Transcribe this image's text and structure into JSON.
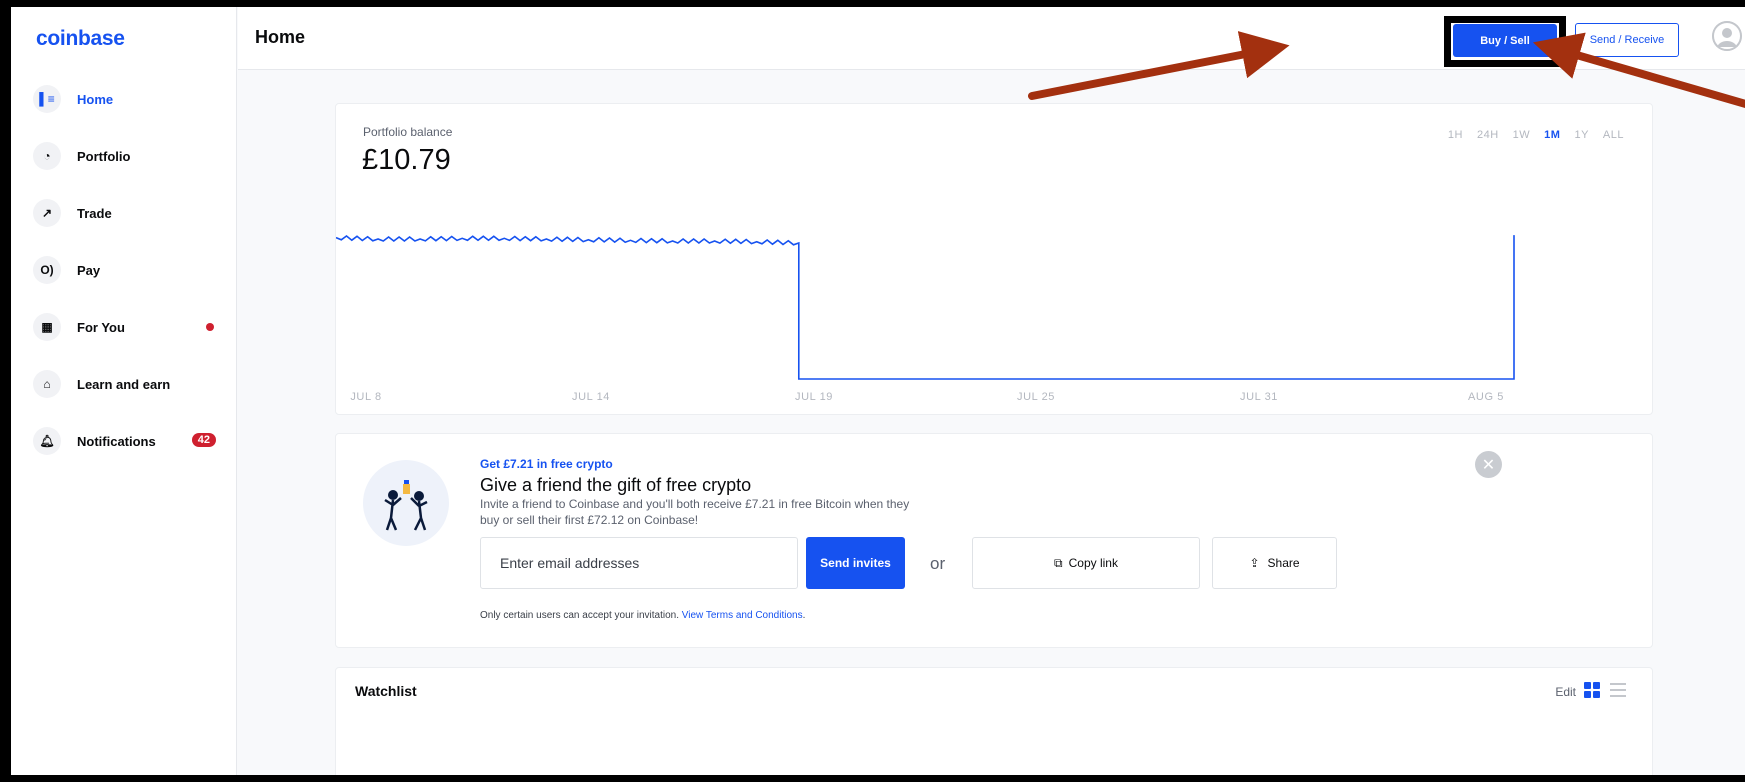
{
  "app": {
    "logo": "coinbase"
  },
  "sidebar": {
    "items": [
      {
        "label": "Home",
        "icon": "home-icon"
      },
      {
        "label": "Portfolio",
        "icon": "pie-chart-icon"
      },
      {
        "label": "Trade",
        "icon": "trend-arrow-icon"
      },
      {
        "label": "Pay",
        "icon": "pay-icon"
      },
      {
        "label": "For You",
        "icon": "for-you-icon"
      },
      {
        "label": "Learn and earn",
        "icon": "gift-icon"
      },
      {
        "label": "Notifications",
        "icon": "bell-icon",
        "badge": "42"
      }
    ]
  },
  "header": {
    "title": "Home",
    "buy_sell": "Buy / Sell",
    "send_receive": "Send / Receive"
  },
  "portfolio": {
    "label": "Portfolio balance",
    "value": "£10.79",
    "ranges": [
      "1H",
      "24H",
      "1W",
      "1M",
      "1Y",
      "ALL"
    ],
    "active_range": "1M",
    "x_ticks": [
      "JUL 8",
      "JUL 14",
      "JUL 19",
      "JUL 25",
      "JUL 31",
      "AUG 5"
    ]
  },
  "chart_data": {
    "type": "line",
    "title": "",
    "xlabel": "",
    "ylabel": "",
    "x_ticks": [
      "JUL 8",
      "JUL 14",
      "JUL 19",
      "JUL 25",
      "JUL 31",
      "AUG 5"
    ],
    "y_visible": false,
    "series": [
      {
        "points": [
          [
            "JUL 8",
            10.6
          ],
          [
            "JUL 9",
            10.5
          ],
          [
            "JUL 10",
            10.5
          ],
          [
            "JUL 11",
            10.55
          ],
          [
            "JUL 12",
            10.55
          ],
          [
            "JUL 13",
            10.5
          ],
          [
            "JUL 14",
            10.45
          ],
          [
            "JUL 15",
            10.4
          ],
          [
            "JUL 16",
            10.35
          ],
          [
            "JUL 17",
            10.35
          ],
          [
            "JUL 18",
            10.3
          ],
          [
            "JUL 19",
            10.2
          ],
          [
            "JUL 20",
            0
          ],
          [
            "AUG 4",
            0
          ],
          [
            "AUG 5",
            10.79
          ]
        ]
      }
    ],
    "color": "#1652f0"
  },
  "referral": {
    "kicker": "Get £7.21 in free crypto",
    "title": "Give a friend the gift of free crypto",
    "description": "Invite a friend to Coinbase and you'll both receive £7.21 in free Bitcoin when they buy or sell their first £72.12 on Coinbase!",
    "email_placeholder": "Enter email addresses",
    "send_invites": "Send invites",
    "or": "or",
    "copy_link": "Copy link",
    "share": "Share",
    "terms_prefix": "Only certain users can accept your invitation.",
    "terms_link": "View Terms and Conditions",
    "terms_suffix": "."
  },
  "watchlist": {
    "title": "Watchlist",
    "edit": "Edit"
  },
  "colors": {
    "brand": "#1652f0",
    "annotation_arrow": "#a3300f",
    "badge": "#cf202f"
  }
}
